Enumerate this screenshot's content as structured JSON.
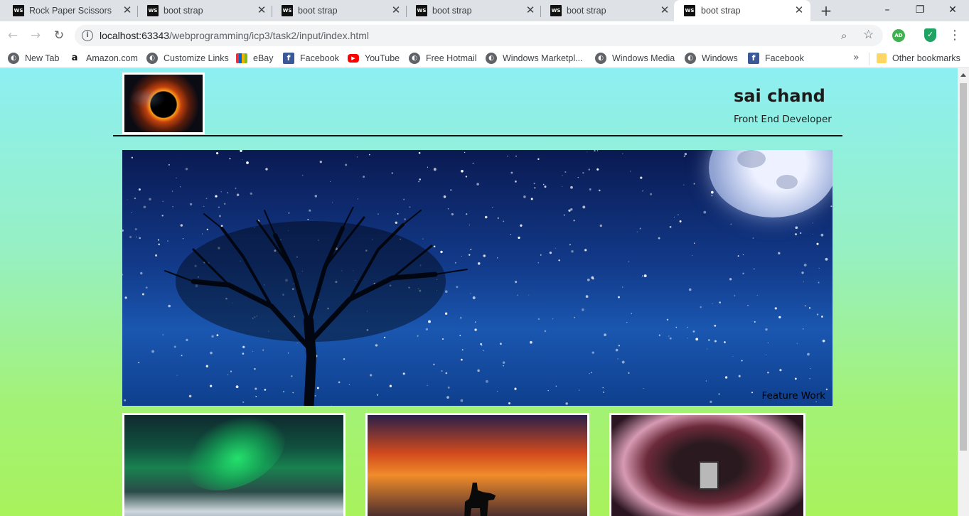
{
  "browser": {
    "tabs": [
      {
        "title": "Rock Paper Scissors",
        "favicon": "ws-icon",
        "active": false
      },
      {
        "title": "boot strap",
        "favicon": "ws-icon",
        "active": false
      },
      {
        "title": "boot strap",
        "favicon": "ws-icon",
        "active": false
      },
      {
        "title": "boot strap",
        "favicon": "ws-icon",
        "active": false
      },
      {
        "title": "boot strap",
        "favicon": "ws-icon",
        "active": false
      },
      {
        "title": "boot strap",
        "favicon": "ws-icon",
        "active": true
      }
    ],
    "favicon_text": "WS",
    "url_host": "localhost:63343",
    "url_path": "/webprogramming/icp3/task2/input/index.html",
    "extension_ad_label": "AD",
    "bookmarks": [
      {
        "label": "New Tab",
        "icon": "globe-icon"
      },
      {
        "label": "Amazon.com",
        "icon": "amazon-icon"
      },
      {
        "label": "Customize Links",
        "icon": "globe-icon"
      },
      {
        "label": "eBay",
        "icon": "ebay-icon"
      },
      {
        "label": "Facebook",
        "icon": "facebook-icon"
      },
      {
        "label": "YouTube",
        "icon": "youtube-icon"
      },
      {
        "label": "Free Hotmail",
        "icon": "globe-icon"
      },
      {
        "label": "Windows Marketpl...",
        "icon": "globe-icon"
      },
      {
        "label": "Windows Media",
        "icon": "globe-icon"
      },
      {
        "label": "Windows",
        "icon": "globe-icon"
      },
      {
        "label": "Facebook",
        "icon": "facebook-icon"
      }
    ],
    "other_bookmarks": "Other bookmarks"
  },
  "page": {
    "name": "sai chand",
    "role": "Front End Developer",
    "feature_caption": "Feature Work",
    "background_top": "#8deff2",
    "background_bottom": "#a8f25c"
  }
}
